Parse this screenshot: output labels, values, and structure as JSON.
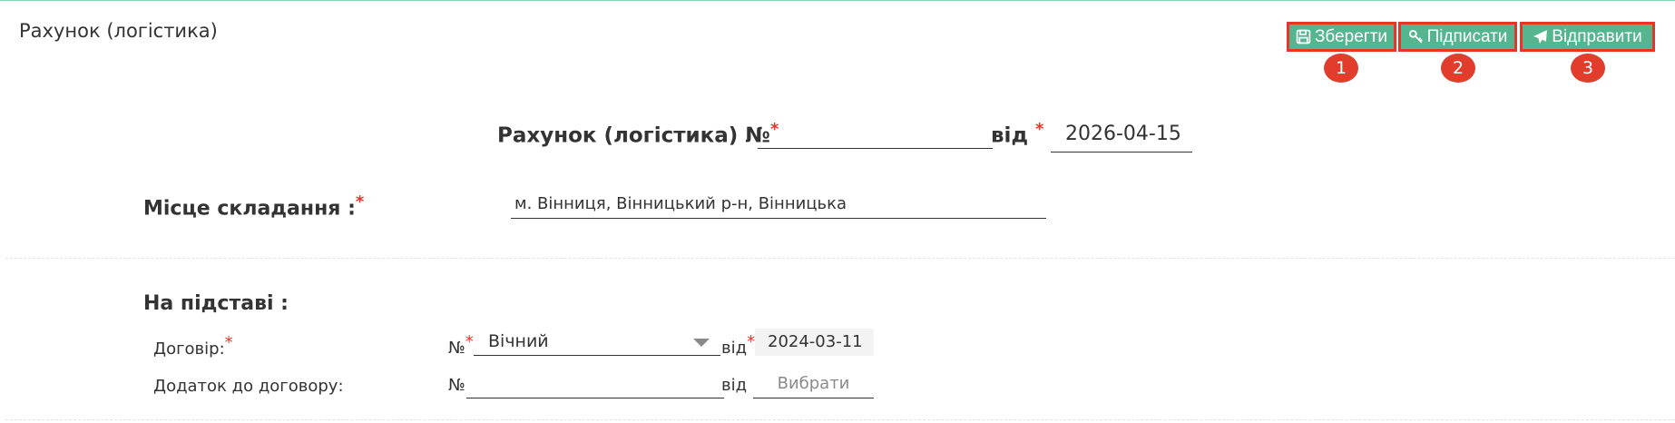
{
  "page": {
    "title": "Рахунок (логістика)"
  },
  "toolbar": {
    "save_label": "Зберегти",
    "sign_label": "Підписати",
    "send_label": "Відправити",
    "badges": [
      "1",
      "2",
      "3"
    ]
  },
  "document": {
    "heading": "Рахунок (логістика) №",
    "required_mark": "*",
    "number_value": "",
    "from_label": "від",
    "date": "2026-04-15"
  },
  "place": {
    "label": "Місце складання :",
    "value": "м. Вінниця, Вінницький р-н, Вінницька"
  },
  "basis": {
    "label": "На підставі :",
    "contract": {
      "label": "Договір:",
      "number_prefix": "№",
      "selected": "Вічний",
      "from_label": "від",
      "date": "2024-03-11"
    },
    "addendum": {
      "label": "Додаток до договору:",
      "number_prefix": "№",
      "number_value": "",
      "from_label": "від",
      "date_placeholder": "Вибрати"
    }
  },
  "colors": {
    "button_bg": "#55b58f",
    "highlight_border": "#e8352a",
    "badge_bg": "#e23d2c",
    "required": "#e8352a"
  }
}
